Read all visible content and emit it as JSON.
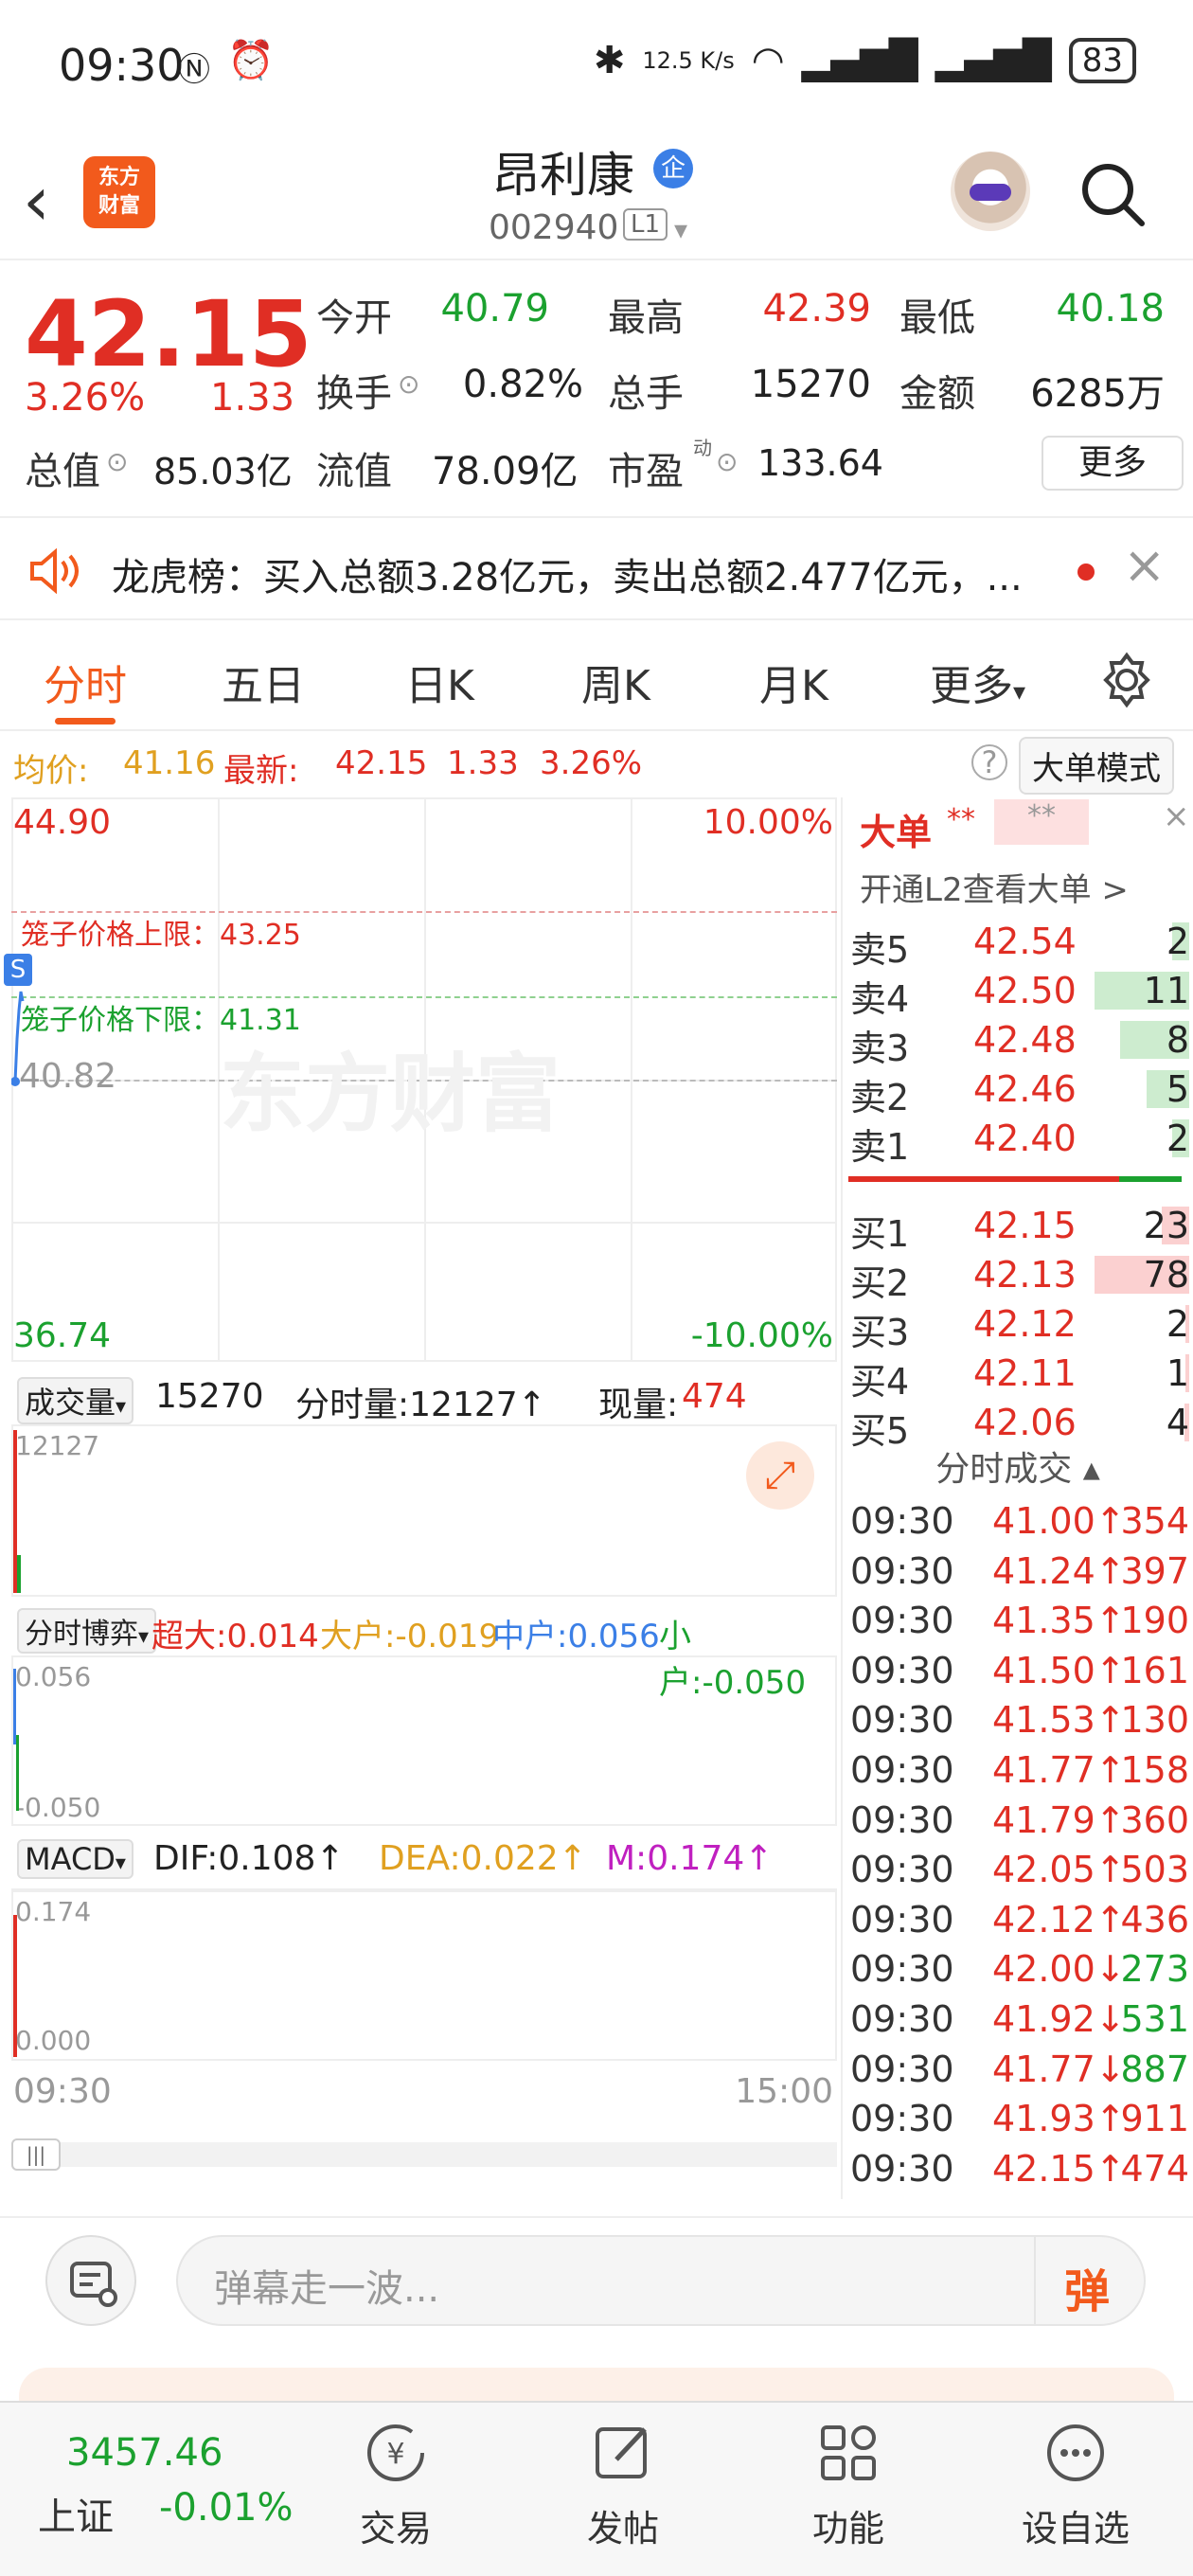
{
  "status": {
    "time": "09:30",
    "net_speed": "12.5 K/s",
    "battery": "83"
  },
  "header": {
    "title": "昂利康",
    "code": "002940",
    "level": "L1",
    "logo_text": "东方\n财富",
    "badge": "企"
  },
  "quote": {
    "price": "42.15",
    "change_pct": "3.26%",
    "change": "1.33",
    "labels": {
      "open": "今开",
      "high": "最高",
      "low": "最低",
      "turnover": "换手",
      "volume": "总手",
      "amount": "金额",
      "total_cap": "总值",
      "float_cap": "流值",
      "pe": "市盈"
    },
    "values": {
      "open": "40.79",
      "high": "42.39",
      "low": "40.18",
      "turnover": "0.82%",
      "volume": "15270",
      "amount": "6285万",
      "total_cap": "85.03亿",
      "float_cap": "78.09亿",
      "pe": "133.64",
      "pe_sup": "动"
    },
    "more": "更多"
  },
  "notice": {
    "text": "龙虎榜：买入总额3.28亿元，卖出总额2.477亿元，..."
  },
  "tabs": [
    "分时",
    "五日",
    "日K",
    "周K",
    "月K",
    "更多"
  ],
  "info_row": {
    "avg_label": "均价:",
    "avg": "41.16",
    "last_label": "最新:",
    "last": "42.15",
    "chg": "1.33",
    "pct": "3.26%",
    "mode_btn": "大单模式"
  },
  "chart": {
    "top_price": "44.90",
    "top_pct": "10.00%",
    "bottom_price": "36.74",
    "bottom_pct": "-10.00%",
    "upper_limit": "笼子价格上限：43.25",
    "lower_limit": "笼子价格下限：41.31",
    "prev_close": "40.82",
    "watermark": "东方财富",
    "vol_label": "成交量",
    "vol_total": "15270",
    "vol_min": "分时量:12127↑",
    "vol_now_label": "现量:",
    "vol_now": "474",
    "vol_axis": "12127",
    "flow_label": "分时博弈",
    "flow_super_label": "超大:",
    "flow_super": "0.014",
    "flow_big_label": "大户:",
    "flow_big": "-0.019",
    "flow_mid_label": "中户:",
    "flow_mid": "0.056",
    "flow_small_label": "小户:",
    "flow_small": "-0.050",
    "flow_axis_top": "0.056",
    "flow_axis_bottom": "-0.050",
    "macd_label": "MACD",
    "macd_dif": "DIF:0.108↑",
    "macd_dea": "DEA:0.022↑",
    "macd_m": "M:0.174↑",
    "macd_axis_top": "0.174",
    "macd_axis_bottom": "0.000",
    "time_start": "09:30",
    "time_end": "15:00"
  },
  "order_book": {
    "big_label": "大单",
    "big_v1": "**",
    "big_v2": "**",
    "l2_link": "开通L2查看大单 >",
    "asks": [
      {
        "label": "卖5",
        "price": "42.54",
        "vol": "2"
      },
      {
        "label": "卖4",
        "price": "42.50",
        "vol": "11"
      },
      {
        "label": "卖3",
        "price": "42.48",
        "vol": "8"
      },
      {
        "label": "卖2",
        "price": "42.46",
        "vol": "5"
      },
      {
        "label": "卖1",
        "price": "42.40",
        "vol": "2"
      }
    ],
    "bids": [
      {
        "label": "买1",
        "price": "42.15",
        "vol": "23"
      },
      {
        "label": "买2",
        "price": "42.13",
        "vol": "78"
      },
      {
        "label": "买3",
        "price": "42.12",
        "vol": "2"
      },
      {
        "label": "买4",
        "price": "42.11",
        "vol": "1"
      },
      {
        "label": "买5",
        "price": "42.06",
        "vol": "4"
      }
    ],
    "ticks_title": "分时成交",
    "ticks": [
      {
        "t": "09:30",
        "p": "41.00↑",
        "v": "354",
        "dir": "up"
      },
      {
        "t": "09:30",
        "p": "41.24↑",
        "v": "397",
        "dir": "up"
      },
      {
        "t": "09:30",
        "p": "41.35↑",
        "v": "190",
        "dir": "up"
      },
      {
        "t": "09:30",
        "p": "41.50↑",
        "v": "161",
        "dir": "up"
      },
      {
        "t": "09:30",
        "p": "41.53↑",
        "v": "130",
        "dir": "up"
      },
      {
        "t": "09:30",
        "p": "41.77↑",
        "v": "158",
        "dir": "up"
      },
      {
        "t": "09:30",
        "p": "41.79↑",
        "v": "360",
        "dir": "up"
      },
      {
        "t": "09:30",
        "p": "42.05↑",
        "v": "503",
        "dir": "up"
      },
      {
        "t": "09:30",
        "p": "42.12↑",
        "v": "436",
        "dir": "up"
      },
      {
        "t": "09:30",
        "p": "42.00↓",
        "v": "273",
        "dir": "down"
      },
      {
        "t": "09:30",
        "p": "41.92↓",
        "v": "531",
        "dir": "down"
      },
      {
        "t": "09:30",
        "p": "41.77↓",
        "v": "887",
        "dir": "down"
      },
      {
        "t": "09:30",
        "p": "41.93↑",
        "v": "911",
        "dir": "up"
      },
      {
        "t": "09:30",
        "p": "42.15↑",
        "v": "474",
        "dir": "up"
      }
    ]
  },
  "comment": {
    "placeholder": "弹幕走一波...",
    "send_icon_text": "弹"
  },
  "bottom_nav": {
    "index_value": "3457.46",
    "index_name": "上证",
    "index_change": "-0.01%",
    "items": [
      "交易",
      "发帖",
      "功能",
      "设自选"
    ]
  }
}
